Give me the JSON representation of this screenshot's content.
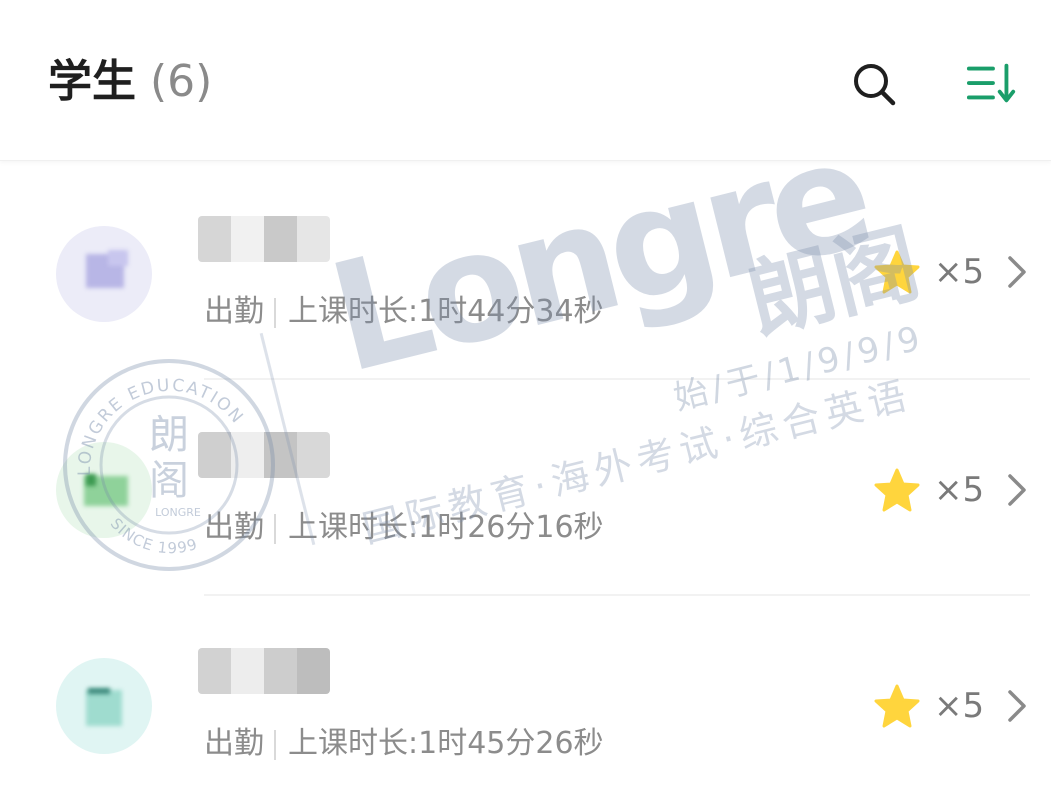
{
  "header": {
    "title": "学生",
    "count": "(6)",
    "search_icon": "search-icon",
    "sort_icon": "sort-icon"
  },
  "colors": {
    "accent": "#1a9e6a",
    "star": "#ffd53d",
    "text_primary": "#1f1f1f",
    "text_secondary": "#8c8c8c"
  },
  "students": [
    {
      "status": "出勤",
      "duration_label": "上课时长:",
      "duration": "1时44分34秒",
      "stars": "×5"
    },
    {
      "status": "出勤",
      "duration_label": "上课时长:",
      "duration": "1时26分16秒",
      "stars": "×5"
    },
    {
      "status": "出勤",
      "duration_label": "上课时长:",
      "duration": "1时45分26秒",
      "stars": "×5"
    }
  ],
  "watermark": {
    "brand": "Longre",
    "brand_cn": "朗阁",
    "since": "始/于/1/9/9/9",
    "slogan": "国际教育·海外考试·综合英语",
    "seal_top": "LONGRE EDUCATION",
    "seal_bottom": "SINCE 1999",
    "seal_center_top": "朗",
    "seal_center_bottom": "阁",
    "seal_small": "LONGRE"
  }
}
